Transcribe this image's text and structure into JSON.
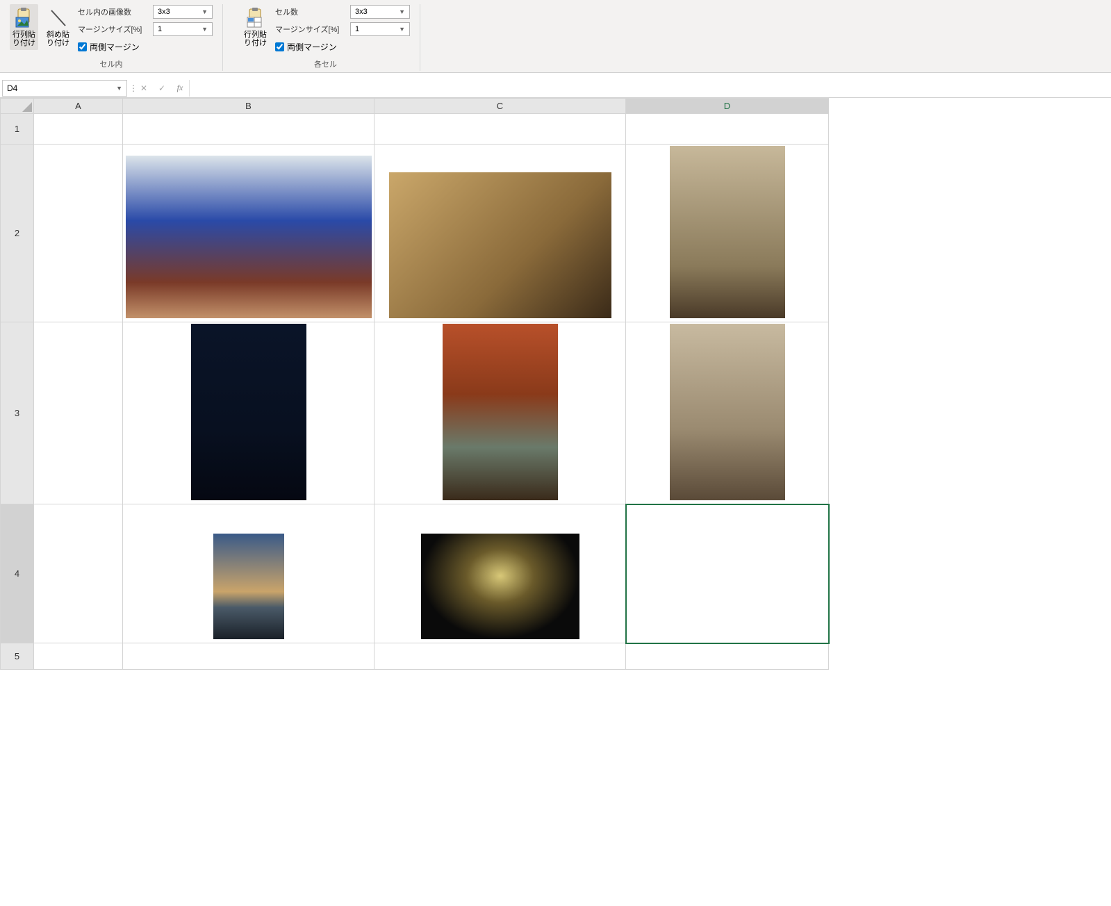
{
  "ribbon": {
    "group1": {
      "paste_label": "行列貼\nり付け",
      "diag_paste_label": "斜め貼\nり付け",
      "images_in_cell_label": "セル内の画像数",
      "images_in_cell_value": "3x3",
      "margin_size_label": "マージンサイズ[%]",
      "margin_size_value": "1",
      "both_margin_label": "両側マージン",
      "group_name": "セル内"
    },
    "group2": {
      "paste_label": "行列貼\nり付け",
      "cell_count_label": "セル数",
      "cell_count_value": "3x3",
      "margin_size_label": "マージンサイズ[%]",
      "margin_size_value": "1",
      "both_margin_label": "両側マージン",
      "group_name": "各セル"
    }
  },
  "formula_bar": {
    "name_box": "D4",
    "fx": "fx"
  },
  "columns": {
    "A": "A",
    "B": "B",
    "C": "C",
    "D": "D"
  },
  "rows": {
    "1": "1",
    "2": "2",
    "3": "3",
    "4": "4",
    "5": "5"
  },
  "selected_cell": "D4"
}
